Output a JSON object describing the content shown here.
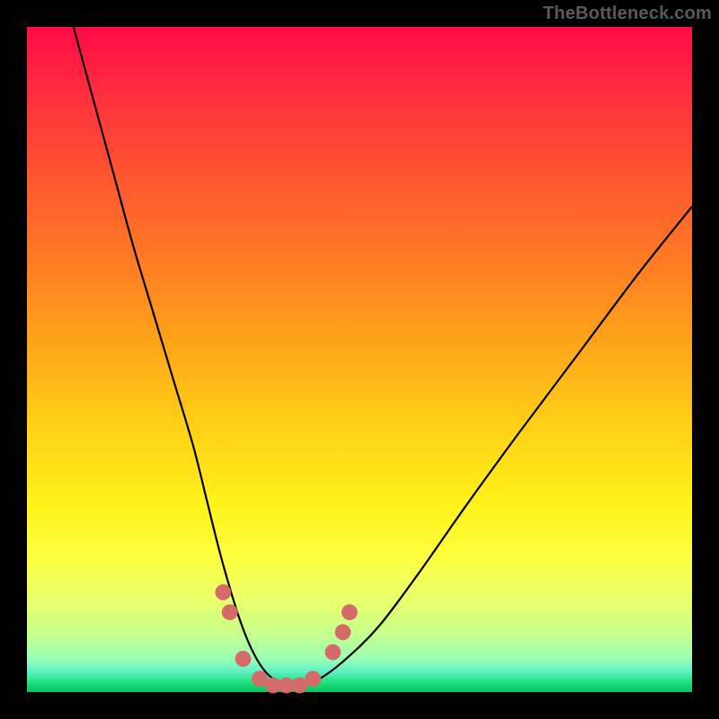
{
  "watermark": "TheBottleneck.com",
  "chart_data": {
    "type": "line",
    "title": "",
    "xlabel": "",
    "ylabel": "",
    "xlim": [
      0,
      100
    ],
    "ylim": [
      0,
      100
    ],
    "grid": false,
    "legend": false,
    "series": [
      {
        "name": "bottleneck-curve",
        "color": "#000000",
        "x": [
          7,
          10,
          13,
          16,
          19,
          22,
          25,
          27,
          29,
          31,
          32.5,
          34,
          35.5,
          37,
          39,
          41,
          44,
          48,
          53,
          59,
          66,
          74,
          83,
          92,
          100
        ],
        "y": [
          100,
          89,
          78,
          67,
          57,
          47,
          37,
          29,
          21,
          14,
          9.5,
          6,
          3.5,
          2,
          1,
          1,
          2,
          5,
          10,
          18,
          28,
          39,
          51,
          63,
          73
        ]
      }
    ],
    "markers": {
      "color": "#d46a6a",
      "radius_percent": 1.2,
      "points": [
        {
          "x": 29.5,
          "y": 15
        },
        {
          "x": 30.5,
          "y": 12
        },
        {
          "x": 32.5,
          "y": 5
        },
        {
          "x": 35,
          "y": 2
        },
        {
          "x": 37,
          "y": 1
        },
        {
          "x": 39,
          "y": 1
        },
        {
          "x": 41,
          "y": 1
        },
        {
          "x": 43,
          "y": 2
        },
        {
          "x": 46,
          "y": 6
        },
        {
          "x": 47.5,
          "y": 9
        },
        {
          "x": 48.5,
          "y": 12
        }
      ]
    },
    "background_gradient": {
      "top": "#ff0b46",
      "bottom": "#00c561"
    }
  }
}
